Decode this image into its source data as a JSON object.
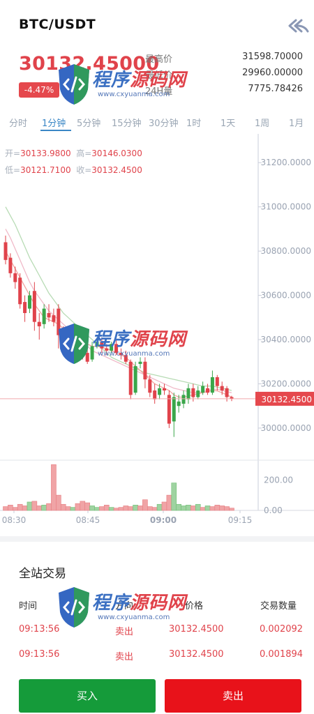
{
  "header": {
    "title": "BTC/USDT"
  },
  "ticker": {
    "last_price": "30132.45000",
    "change_pct": "-4.47%",
    "stats": [
      {
        "label": "最高价",
        "value": "31598.70000"
      },
      {
        "label": "最低价",
        "value": "29960.00000"
      },
      {
        "label": "24H量",
        "value": "7775.78426"
      }
    ]
  },
  "tabs": [
    "分时",
    "1分钟",
    "5分钟",
    "15分钟",
    "30分钟",
    "1时",
    "1天",
    "1周",
    "1月"
  ],
  "active_tab": "1分钟",
  "ohlc": {
    "open_label": "开=",
    "open": "30133.9800",
    "high_label": "高=",
    "high": "30146.0300",
    "low_label": "低=",
    "low": "30121.7100",
    "close_label": "收=",
    "close": "30132.4500"
  },
  "chart_data": {
    "type": "candlestick",
    "y_ticks": [
      "31200.0000",
      "31000.0000",
      "30800.0000",
      "30600.0000",
      "30400.0000",
      "30200.0000",
      "30000.0000"
    ],
    "y_range": [
      29880,
      31330
    ],
    "x_ticks": [
      "08:30",
      "08:45",
      "09:00",
      "09:15"
    ],
    "current_price_label": "30132.4500",
    "current_price": 30132.45,
    "volume_ticks": [
      "200.00",
      "0.00"
    ],
    "volume_range": [
      0,
      320
    ],
    "candles": [
      {
        "o": 30840,
        "c": 30760,
        "h": 30870,
        "l": 30740
      },
      {
        "o": 30770,
        "c": 30700,
        "h": 30790,
        "l": 30680
      },
      {
        "o": 30700,
        "c": 30660,
        "h": 30730,
        "l": 30630
      },
      {
        "o": 30680,
        "c": 30560,
        "h": 30700,
        "l": 30540
      },
      {
        "o": 30570,
        "c": 30520,
        "h": 30600,
        "l": 30480
      },
      {
        "o": 30540,
        "c": 30600,
        "h": 30620,
        "l": 30520
      },
      {
        "o": 30620,
        "c": 30480,
        "h": 30660,
        "l": 30440
      },
      {
        "o": 30480,
        "c": 30460,
        "h": 30520,
        "l": 30400
      },
      {
        "o": 30470,
        "c": 30540,
        "h": 30560,
        "l": 30450
      },
      {
        "o": 30520,
        "c": 30500,
        "h": 30560,
        "l": 30480
      },
      {
        "o": 30510,
        "c": 30480,
        "h": 30540,
        "l": 30460
      },
      {
        "o": 30540,
        "c": 30420,
        "h": 30560,
        "l": 30360
      },
      {
        "o": 30420,
        "c": 30400,
        "h": 30460,
        "l": 30380
      },
      {
        "o": 30420,
        "c": 30380,
        "h": 30440,
        "l": 30360
      },
      {
        "o": 30390,
        "c": 30420,
        "h": 30430,
        "l": 30380
      },
      {
        "o": 30400,
        "c": 30370,
        "h": 30420,
        "l": 30350
      },
      {
        "o": 30380,
        "c": 30330,
        "h": 30400,
        "l": 30310
      },
      {
        "o": 30340,
        "c": 30300,
        "h": 30360,
        "l": 30290
      },
      {
        "o": 30310,
        "c": 30370,
        "h": 30390,
        "l": 30300
      },
      {
        "o": 30370,
        "c": 30390,
        "h": 30410,
        "l": 30360
      },
      {
        "o": 30390,
        "c": 30360,
        "h": 30410,
        "l": 30340
      },
      {
        "o": 30360,
        "c": 30350,
        "h": 30380,
        "l": 30330
      },
      {
        "o": 30350,
        "c": 30380,
        "h": 30390,
        "l": 30340
      },
      {
        "o": 30380,
        "c": 30340,
        "h": 30400,
        "l": 30330
      },
      {
        "o": 30340,
        "c": 30330,
        "h": 30360,
        "l": 30310
      },
      {
        "o": 30330,
        "c": 30300,
        "h": 30350,
        "l": 30290
      },
      {
        "o": 30300,
        "c": 30150,
        "h": 30310,
        "l": 30130
      },
      {
        "o": 30160,
        "c": 30280,
        "h": 30300,
        "l": 30150
      },
      {
        "o": 30290,
        "c": 30300,
        "h": 30320,
        "l": 30270
      },
      {
        "o": 30300,
        "c": 30220,
        "h": 30320,
        "l": 30180
      },
      {
        "o": 30220,
        "c": 30160,
        "h": 30240,
        "l": 30140
      },
      {
        "o": 30170,
        "c": 30130,
        "h": 30200,
        "l": 30110
      },
      {
        "o": 30150,
        "c": 30180,
        "h": 30200,
        "l": 30130
      },
      {
        "o": 30180,
        "c": 30170,
        "h": 30200,
        "l": 30150
      },
      {
        "o": 30150,
        "c": 30020,
        "h": 30170,
        "l": 30000
      },
      {
        "o": 30030,
        "c": 30140,
        "h": 30160,
        "l": 29960
      },
      {
        "o": 30100,
        "c": 30120,
        "h": 30150,
        "l": 30070
      },
      {
        "o": 30110,
        "c": 30150,
        "h": 30170,
        "l": 30090
      },
      {
        "o": 30130,
        "c": 30180,
        "h": 30200,
        "l": 30110
      },
      {
        "o": 30180,
        "c": 30140,
        "h": 30200,
        "l": 30120
      },
      {
        "o": 30140,
        "c": 30170,
        "h": 30190,
        "l": 30130
      },
      {
        "o": 30160,
        "c": 30190,
        "h": 30210,
        "l": 30150
      },
      {
        "o": 30180,
        "c": 30160,
        "h": 30200,
        "l": 30150
      },
      {
        "o": 30160,
        "c": 30230,
        "h": 30260,
        "l": 30150
      },
      {
        "o": 30230,
        "c": 30190,
        "h": 30240,
        "l": 30170
      },
      {
        "o": 30190,
        "c": 30170,
        "h": 30210,
        "l": 30150
      },
      {
        "o": 30180,
        "c": 30140,
        "h": 30190,
        "l": 30120
      },
      {
        "o": 30140,
        "c": 30133,
        "h": 30146,
        "l": 30122
      }
    ],
    "volumes": [
      {
        "v": 25,
        "up": false
      },
      {
        "v": 35,
        "up": false
      },
      {
        "v": 20,
        "up": false
      },
      {
        "v": 40,
        "up": false
      },
      {
        "v": 30,
        "up": false
      },
      {
        "v": 55,
        "up": true
      },
      {
        "v": 60,
        "up": false
      },
      {
        "v": 30,
        "up": false
      },
      {
        "v": 35,
        "up": true
      },
      {
        "v": 45,
        "up": false
      },
      {
        "v": 300,
        "up": false
      },
      {
        "v": 100,
        "up": false
      },
      {
        "v": 40,
        "up": false
      },
      {
        "v": 25,
        "up": false
      },
      {
        "v": 20,
        "up": true
      },
      {
        "v": 45,
        "up": false
      },
      {
        "v": 60,
        "up": false
      },
      {
        "v": 50,
        "up": false
      },
      {
        "v": 30,
        "up": true
      },
      {
        "v": 20,
        "up": true
      },
      {
        "v": 25,
        "up": false
      },
      {
        "v": 35,
        "up": false
      },
      {
        "v": 20,
        "up": true
      },
      {
        "v": 15,
        "up": false
      },
      {
        "v": 20,
        "up": false
      },
      {
        "v": 30,
        "up": false
      },
      {
        "v": 25,
        "up": false
      },
      {
        "v": 35,
        "up": true
      },
      {
        "v": 30,
        "up": false
      },
      {
        "v": 70,
        "up": false
      },
      {
        "v": 25,
        "up": false
      },
      {
        "v": 20,
        "up": false
      },
      {
        "v": 40,
        "up": true
      },
      {
        "v": 55,
        "up": false
      },
      {
        "v": 100,
        "up": false
      },
      {
        "v": 180,
        "up": true
      },
      {
        "v": 40,
        "up": true
      },
      {
        "v": 30,
        "up": true
      },
      {
        "v": 35,
        "up": true
      },
      {
        "v": 30,
        "up": false
      },
      {
        "v": 40,
        "up": true
      },
      {
        "v": 20,
        "up": false
      },
      {
        "v": 30,
        "up": true
      },
      {
        "v": 25,
        "up": false
      },
      {
        "v": 35,
        "up": false
      },
      {
        "v": 30,
        "up": false
      },
      {
        "v": 25,
        "up": false
      },
      {
        "v": 15,
        "up": false
      }
    ],
    "ma_lines": [
      {
        "color": "#b7dbb4",
        "values": [
          31000,
          30960,
          30920,
          30870,
          30820,
          30770,
          30730,
          30690,
          30650,
          30610,
          30580,
          30550,
          30520,
          30500,
          30480,
          30460,
          30440,
          30420,
          30400,
          30380,
          30360,
          30340,
          30320,
          30310,
          30300,
          30290,
          30280,
          30270,
          30260,
          30250,
          30245,
          30240,
          30235,
          30230,
          30225,
          30220,
          30215,
          30210,
          30205,
          30200,
          30195,
          30190,
          30190,
          30190,
          30185,
          30180,
          30175,
          30170
        ]
      },
      {
        "color": "#f0b9c8",
        "values": [
          30900,
          30860,
          30810,
          30760,
          30710,
          30660,
          30620,
          30590,
          30560,
          30530,
          30510,
          30490,
          30470,
          30450,
          30430,
          30410,
          30390,
          30370,
          30350,
          30340,
          30330,
          30320,
          30310,
          30300,
          30290,
          30280,
          30270,
          30260,
          30250,
          30240,
          30230,
          30220,
          30210,
          30200,
          30190,
          30180,
          30175,
          30170,
          30165,
          30160,
          30160,
          30165,
          30170,
          30175,
          30175,
          30170,
          30165,
          30160
        ]
      },
      {
        "color": "#f2a4a0",
        "values": [
          30800,
          30760,
          30720,
          30680,
          30640,
          30600,
          30560,
          30530,
          30500,
          30490,
          30480,
          30470,
          30450,
          30430,
          30410,
          30400,
          30390,
          30380,
          30370,
          30370,
          30365,
          30360,
          30350,
          30340,
          30330,
          30320,
          30300,
          30280,
          30260,
          30240,
          30220,
          30200,
          30190,
          30180,
          30170,
          30150,
          30140,
          30140,
          30145,
          30150,
          30155,
          30160,
          30165,
          30170,
          30168,
          30160,
          30150,
          30140
        ]
      }
    ]
  },
  "trades": {
    "title": "全站交易",
    "columns": [
      "时间",
      "方向",
      "价格",
      "交易数量"
    ],
    "rows": [
      {
        "time": "09:13:56",
        "side": "卖出",
        "price": "30132.4500",
        "amount": "0.002092"
      },
      {
        "time": "09:13:56",
        "side": "卖出",
        "price": "30132.4500",
        "amount": "0.001894"
      }
    ]
  },
  "actions": {
    "buy": "买入",
    "sell": "卖出"
  },
  "watermark": {
    "text_a": "程序",
    "text_b": "源码网",
    "url": "www.cxyuanma.com"
  },
  "colors": {
    "up": "#3aa64a",
    "down": "#e0434b",
    "accent": "#3a87c6",
    "buy": "#159b3a",
    "sell": "#e8121a"
  }
}
